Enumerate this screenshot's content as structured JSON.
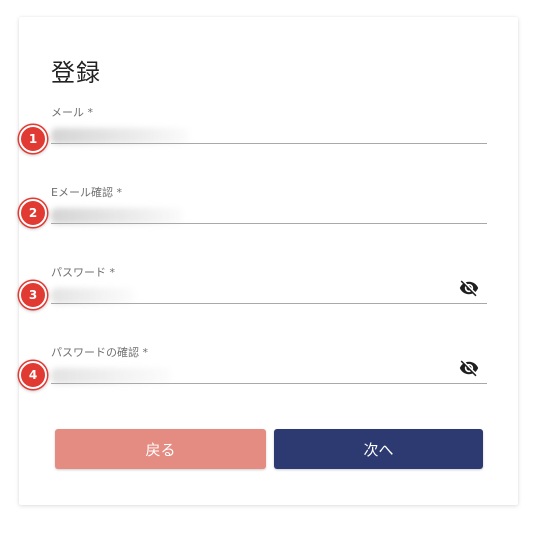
{
  "form": {
    "title": "登録",
    "fields": [
      {
        "label": "メール *",
        "value_hidden": true,
        "marker": "1"
      },
      {
        "label": "Eメール確認 *",
        "value_hidden": true,
        "marker": "2"
      },
      {
        "label": "パスワード *",
        "value_hidden": true,
        "marker": "3",
        "toggle_icon": "eye-off-icon"
      },
      {
        "label": "パスワードの確認 *",
        "value_hidden": true,
        "marker": "4",
        "toggle_icon": "eye-off-icon"
      }
    ],
    "buttons": {
      "back_label": "戻る",
      "next_label": "次へ"
    }
  },
  "colors": {
    "back_button": "#e48b82",
    "next_button": "#2d3a72",
    "marker": "#e03a33",
    "underline": "#a9a9a9"
  }
}
